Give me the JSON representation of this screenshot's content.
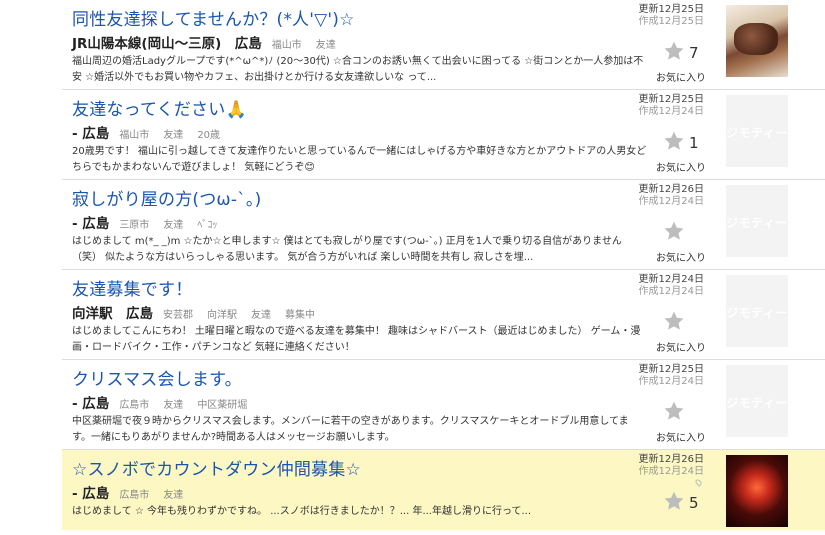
{
  "icons": {
    "favorite": "star-icon",
    "placeholder": "jmty-logo"
  },
  "colors": {
    "title_link": "#1a55b0",
    "featured_bg": "#fcf7c3"
  },
  "posts": [
    {
      "title": "同性友達探してませんか？(*人'▽')☆",
      "location": "JR山陽本線(岡山〜三原)　広島",
      "tags": [
        "福山市",
        "友達"
      ],
      "description": "福山周辺の婚活Ladyグループです(*^ω^*)ﾉ (20〜30代) ☆合コンのお誘い無くて出会いに困ってる ☆街コンとか一人参加は不安 ☆婚活以外でもお買い物やカフェ、お出掛けとか行ける女友達欲しいな って...",
      "updated": "更新12月25日",
      "created": "作成12月25日",
      "fav_count": "7",
      "fav_label": "お気に入り",
      "thumb": "photo"
    },
    {
      "title": "友達なってください🙏",
      "location": "- 広島",
      "tags": [
        "福山市",
        "友達",
        "20歳"
      ],
      "description": "20歳男です！ 福山に引っ越してきて友達作りたいと思っているんで一緒にはしゃげる方や車好きな方とかアウトドアの人男女どちらでもかまわないんで遊びましょ！ 気軽にどうぞ😊",
      "updated": "更新12月25日",
      "created": "作成12月24日",
      "fav_count": "1",
      "fav_label": "お気に入り",
      "thumb": "placeholder",
      "placeholder_text": "ジモティー"
    },
    {
      "title": "寂しがり屋の方(つω-`。)",
      "location": "- 広島",
      "tags": [
        "三原市",
        "友達",
        "ﾍﾟｺｯ"
      ],
      "description": "はじめまして m(*_ _)m ☆たか☆と申します☆ 僕はとても寂しがり屋です(つω-`。) 正月を1人で乗り切る自信がありません（笑） 似たような方はいらっしゃる思います。 気が合う方がいれば 楽しい時間を共有し 寂しさを埋...",
      "updated": "更新12月26日",
      "created": "作成12月24日",
      "fav_count": "",
      "fav_label": "お気に入り",
      "thumb": "placeholder",
      "placeholder_text": "ジモティー"
    },
    {
      "title": "友達募集です！",
      "location": "向洋駅　広島",
      "tags": [
        "安芸郡",
        "向洋駅",
        "友達",
        "募集中"
      ],
      "description": "はじめましてこんにちわ！ 土曜日曜と暇なので遊べる友達を募集中！ 趣味はシャドバースト（最近はじめました） ゲーム・漫画・ロードバイク・工作・パチンコなど 気軽に連絡ください！",
      "updated": "更新12月24日",
      "created": "作成12月24日",
      "fav_count": "",
      "fav_label": "お気に入り",
      "thumb": "placeholder",
      "placeholder_text": "ジモティー"
    },
    {
      "title": "クリスマス会します。",
      "location": "- 広島",
      "tags": [
        "広島市",
        "友達",
        "中区薬研堀"
      ],
      "description": "中区薬研堀で夜９時からクリスマス会します。メンバーに若干の空きがあります。クリスマスケーキとオードブル用意してます。一緒にもりあがりませんか?時間ある人はメッセージお願いします。",
      "updated": "更新12月25日",
      "created": "作成12月24日",
      "fav_count": "",
      "fav_label": "お気に入り",
      "thumb": "placeholder",
      "placeholder_text": "ジモティー"
    },
    {
      "title": "☆スノボでカウントダウン仲間募集☆",
      "location": "- 広島",
      "tags": [
        "広島市",
        "友達"
      ],
      "description": "はじめまして ☆ 今年も残りわずかですね。 ...スノボは行きましたか！？... 年...年越し滑りに行って...",
      "updated": "更新12月26日",
      "created": "作成12月24日",
      "fav_count": "5",
      "fav_label": "お気に入り",
      "thumb": "photo"
    }
  ]
}
